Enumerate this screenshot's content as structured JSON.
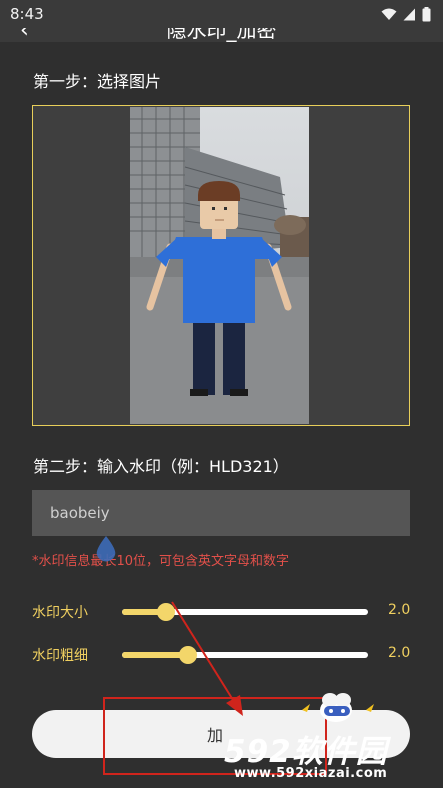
{
  "status_bar": {
    "time": "8:43"
  },
  "app_bar": {
    "title": "隐水印_加密"
  },
  "step1": {
    "label": "第一步：选择图片"
  },
  "step2": {
    "label": "第二步：输入水印（例：HLD321）"
  },
  "watermark_input": {
    "value": "baobeiy"
  },
  "hint": {
    "text": "*水印信息最长10位，可包含英文字母和数字"
  },
  "sliders": [
    {
      "label": "水印大小",
      "value_text": "2.0",
      "level": 0.18
    },
    {
      "label": "水印粗细",
      "value_text": "2.0",
      "level": 0.27
    }
  ],
  "add_button": {
    "label": "加"
  },
  "site_watermark": {
    "brand": "592软件园",
    "url": "www.592xiazai.com"
  },
  "colors": {
    "background": "#2f2f2f",
    "accent": "#f3d66a",
    "hint": "#e2504a",
    "annotation": "#d0241c"
  }
}
